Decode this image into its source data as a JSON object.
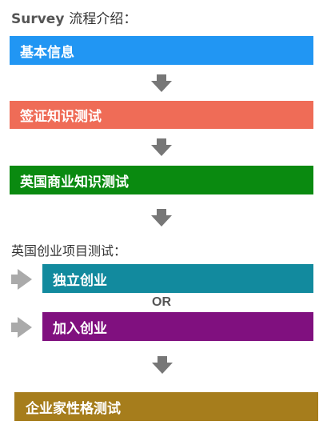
{
  "heading": {
    "prefix": "Survey",
    "suffix": "流程介绍："
  },
  "steps": [
    {
      "label": "基本信息",
      "color": "#2196f3"
    },
    {
      "label": "签证知识测试",
      "color": "#ef6c57"
    },
    {
      "label": "英国商业知识测试",
      "color": "#0a8a10"
    }
  ],
  "business_section": {
    "title": "英国创业项目测试：",
    "options": [
      {
        "label": "独立创业",
        "color": "#128a9e"
      },
      {
        "label": "加入创业",
        "color": "#80107f"
      }
    ],
    "or_label": "OR"
  },
  "final_step": {
    "label": "企业家性格测试",
    "color": "#a67d1c"
  },
  "arrow_color": "#777777",
  "icons": {
    "down_arrow": "arrow-down-icon",
    "right_arrow": "arrow-right-icon"
  }
}
